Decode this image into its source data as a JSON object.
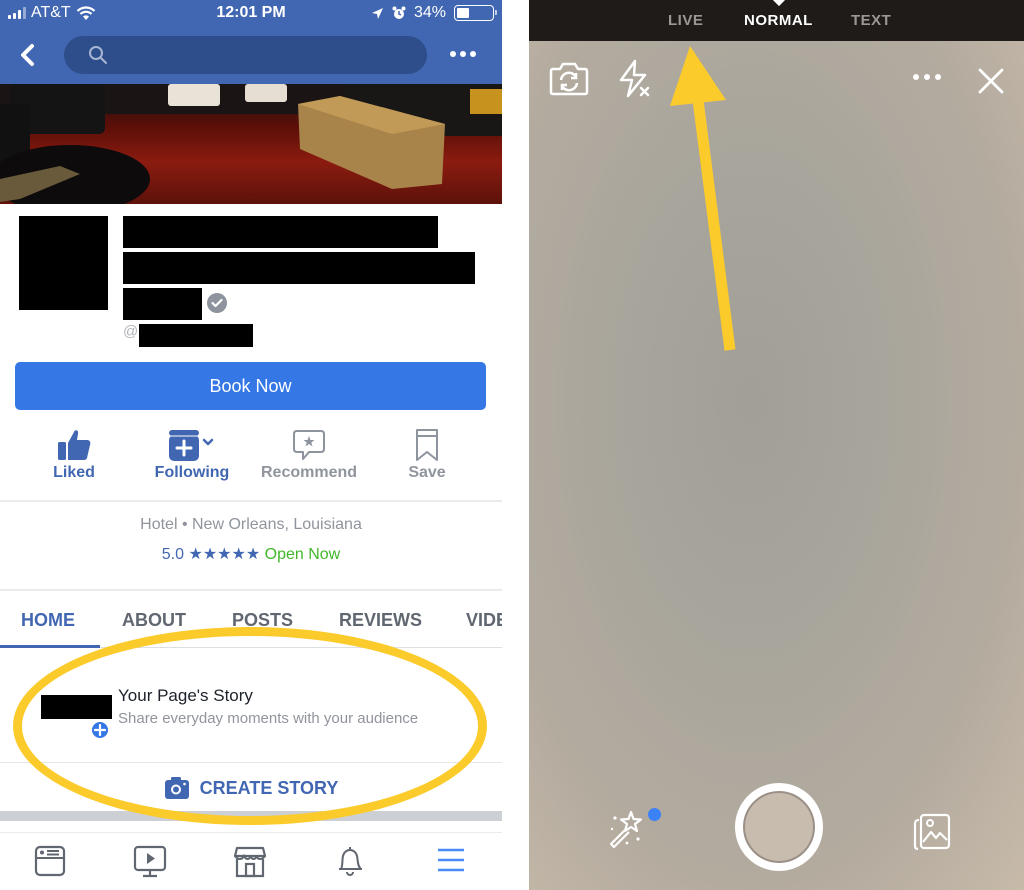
{
  "left_panel": {
    "status_bar": {
      "carrier": "AT&T",
      "time": "12:01 PM",
      "battery_percent": "34%",
      "battery_level": 0.34
    },
    "nav": {
      "search_placeholder": "",
      "back_icon": "chevron-left-icon",
      "more_icon": "ellipsis-icon"
    },
    "page": {
      "username_prefix": "@",
      "verified_icon": "checkmark-circle-icon"
    },
    "book_button": "Book Now",
    "actions": [
      {
        "label": "Liked",
        "icon": "thumbs-up-icon",
        "color": "#4267b2"
      },
      {
        "label": "Following",
        "icon": "following-icon",
        "color": "#4267b2"
      },
      {
        "label": "Recommend",
        "icon": "recommend-icon",
        "color": "#90949c"
      },
      {
        "label": "Save",
        "icon": "bookmark-icon",
        "color": "#90949c"
      }
    ],
    "info": {
      "category": "Hotel • New Orleans, Louisiana",
      "rating": "5.0",
      "stars": "★★★★★",
      "rating_value": 5,
      "open_status": "Open Now"
    },
    "tabs": [
      {
        "label": "HOME",
        "active": true
      },
      {
        "label": "ABOUT",
        "active": false
      },
      {
        "label": "POSTS",
        "active": false
      },
      {
        "label": "REVIEWS",
        "active": false
      },
      {
        "label": "VIDEOS",
        "active": false
      }
    ],
    "story": {
      "title": "Your Page's Story",
      "subtitle": "Share everyday moments with your audience",
      "create_label": "CREATE STORY"
    },
    "bottom_tabs": [
      {
        "icon": "news-feed-icon"
      },
      {
        "icon": "watch-video-icon"
      },
      {
        "icon": "marketplace-icon"
      },
      {
        "icon": "notifications-bell-icon"
      },
      {
        "icon": "menu-icon",
        "active": true
      }
    ]
  },
  "right_panel": {
    "modes": [
      {
        "label": "LIVE",
        "active": false
      },
      {
        "label": "NORMAL",
        "active": true
      },
      {
        "label": "TEXT",
        "active": false
      }
    ],
    "top_icons": [
      "switch-camera-icon",
      "flash-off-icon",
      "more-options-icon",
      "close-icon"
    ],
    "bottom_icons": [
      "effects-wand-icon",
      "shutter-button",
      "gallery-icon"
    ]
  },
  "annotations": {
    "color": "#fbcb2c",
    "shapes": [
      "arrow-pointing-to-live",
      "ellipse-around-create-story"
    ]
  }
}
